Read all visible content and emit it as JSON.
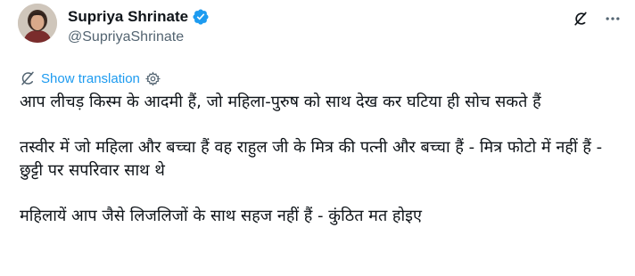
{
  "author": {
    "display_name": "Supriya Shrinate",
    "handle": "@SupriyaShrinate",
    "verified_icon": "verified-badge-icon",
    "verified_color": "#1d9bf0"
  },
  "actions": {
    "grok_icon": "grok-icon",
    "more_icon": "more-icon"
  },
  "translation": {
    "link_label": "Show translation",
    "link_color": "#1d9bf0",
    "icon": "translate-icon",
    "settings_icon": "gear-icon"
  },
  "tweet": {
    "paragraphs": [
      "आप लीचड़ किस्म के आदमी हैं, जो महिला-पुरुष को साथ देख कर घटिया ही सोच सकते हैं",
      "तस्वीर में जो महिला और बच्चा हैं वह राहुल जी के मित्र की पत्नी और बच्चा हैं - मित्र फोटो में नहीं हैं - छुट्टी पर सपरिवार साथ थे",
      "महिलायें आप जैसे लिजलिजों के साथ सहज नहीं हैं - कुंठित मत होइए"
    ]
  }
}
